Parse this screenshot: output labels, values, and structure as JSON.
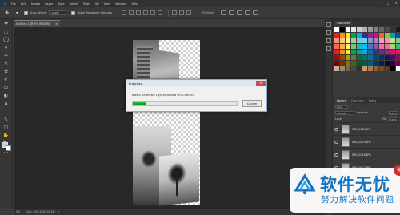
{
  "menubar": {
    "logo": "Ps",
    "items": [
      "File",
      "Edit",
      "Image",
      "Layer",
      "Type",
      "Select",
      "Filter",
      "3D",
      "View",
      "Window",
      "Help"
    ],
    "window_controls": [
      "–",
      "□",
      "✕"
    ]
  },
  "options_bar": {
    "auto_select_label": "Auto-Select:",
    "auto_select_value": "Layer",
    "show_transform_label": "Show Transform Controls",
    "mode_label": "3D Mode:"
  },
  "doc_tab": {
    "title": "Untitled-1 @ 5% (RGB/8)",
    "close": "×"
  },
  "toolbar": {
    "tools": [
      "✥",
      "⬚",
      "◯",
      "⌑",
      "⊹",
      "✎",
      "⚒",
      "✐",
      "▭",
      "◐",
      "⌂",
      "T",
      "↖",
      "▢",
      "✋",
      "🔍",
      "…"
    ]
  },
  "dialog": {
    "title": "Progress",
    "close": "✕",
    "message": "Blend Selected Layers Based On Content",
    "progress": 0.13,
    "cancel_label": "Cancel"
  },
  "status": {
    "zoom": "5%",
    "doc_info": "Doc: 108.0M/210.4M",
    "arrow": ">"
  },
  "panels": {
    "swatch_tabs": [
      "Swatches"
    ],
    "swatch_colors": [
      "#ffffff",
      "#000000",
      "#ffffff",
      "#e6e6e6",
      "#cccccc",
      "#b3b3b3",
      "#999999",
      "#808080",
      "#666666",
      "#4d4d4d",
      "#333333",
      "#1a1a1a",
      "#ed1c24",
      "#f7941d",
      "#fff200",
      "#00a651",
      "#00aeef",
      "#2e3192",
      "#92278f",
      "#ec008c",
      "#f26522",
      "#8dc63f",
      "#00a99d",
      "#0054a6",
      "#f69679",
      "#fdc689",
      "#fff799",
      "#a3d39c",
      "#7accc8",
      "#6dcff6",
      "#8393ca",
      "#a186be",
      "#f49ac1",
      "#f5989d",
      "#c4df9b",
      "#82ca9c",
      "#f26c4f",
      "#fbaf5d",
      "#fff568",
      "#7cc576",
      "#1cbbb4",
      "#00bff3",
      "#5674b9",
      "#855fa8",
      "#f06eaa",
      "#ef6ea2",
      "#acd373",
      "#3cb878",
      "#ed1c24",
      "#f7941d",
      "#fff200",
      "#00a651",
      "#00a99d",
      "#00aeef",
      "#0072bc",
      "#2e3192",
      "#662d91",
      "#92278f",
      "#ec008c",
      "#ed145b",
      "#9e0b0f",
      "#a0410d",
      "#aba000",
      "#598527",
      "#007236",
      "#00746b",
      "#0076a3",
      "#004a80",
      "#003471",
      "#1b1464",
      "#440e62",
      "#9e005d",
      "#790000",
      "#7b2e00",
      "#827b00",
      "#406618",
      "#005e20",
      "#005952",
      "#005b7f",
      "#003663",
      "#002157",
      "#0d004c",
      "#32004b",
      "#7b0046",
      "#c7b299",
      "#998675",
      "#736357",
      "#534741",
      "#37302a",
      "#c69c6d",
      "#a67c52",
      "#8c6239",
      "#754c24",
      "#603913",
      "#000000",
      "#ffffff"
    ],
    "layer_tabs": [
      "Layers",
      "Channels",
      "Paths"
    ],
    "filter_label": "Kind",
    "blend_mode": "Normal",
    "opacity_label": "Opacity:",
    "opacity_value": "100%",
    "lock_label": "Lock:",
    "fill_label": "Fill:",
    "fill_value": "100%",
    "layers": [
      "IMG_0020.JPG",
      "IMG_0019.JPG",
      "IMG_0018.JPG",
      "IMG_0017.JPG",
      "IMG_0016.JPG"
    ]
  },
  "watermark": {
    "title": "软件无忧",
    "subtitle": "努力解决软件问题",
    "bubble": "+"
  }
}
